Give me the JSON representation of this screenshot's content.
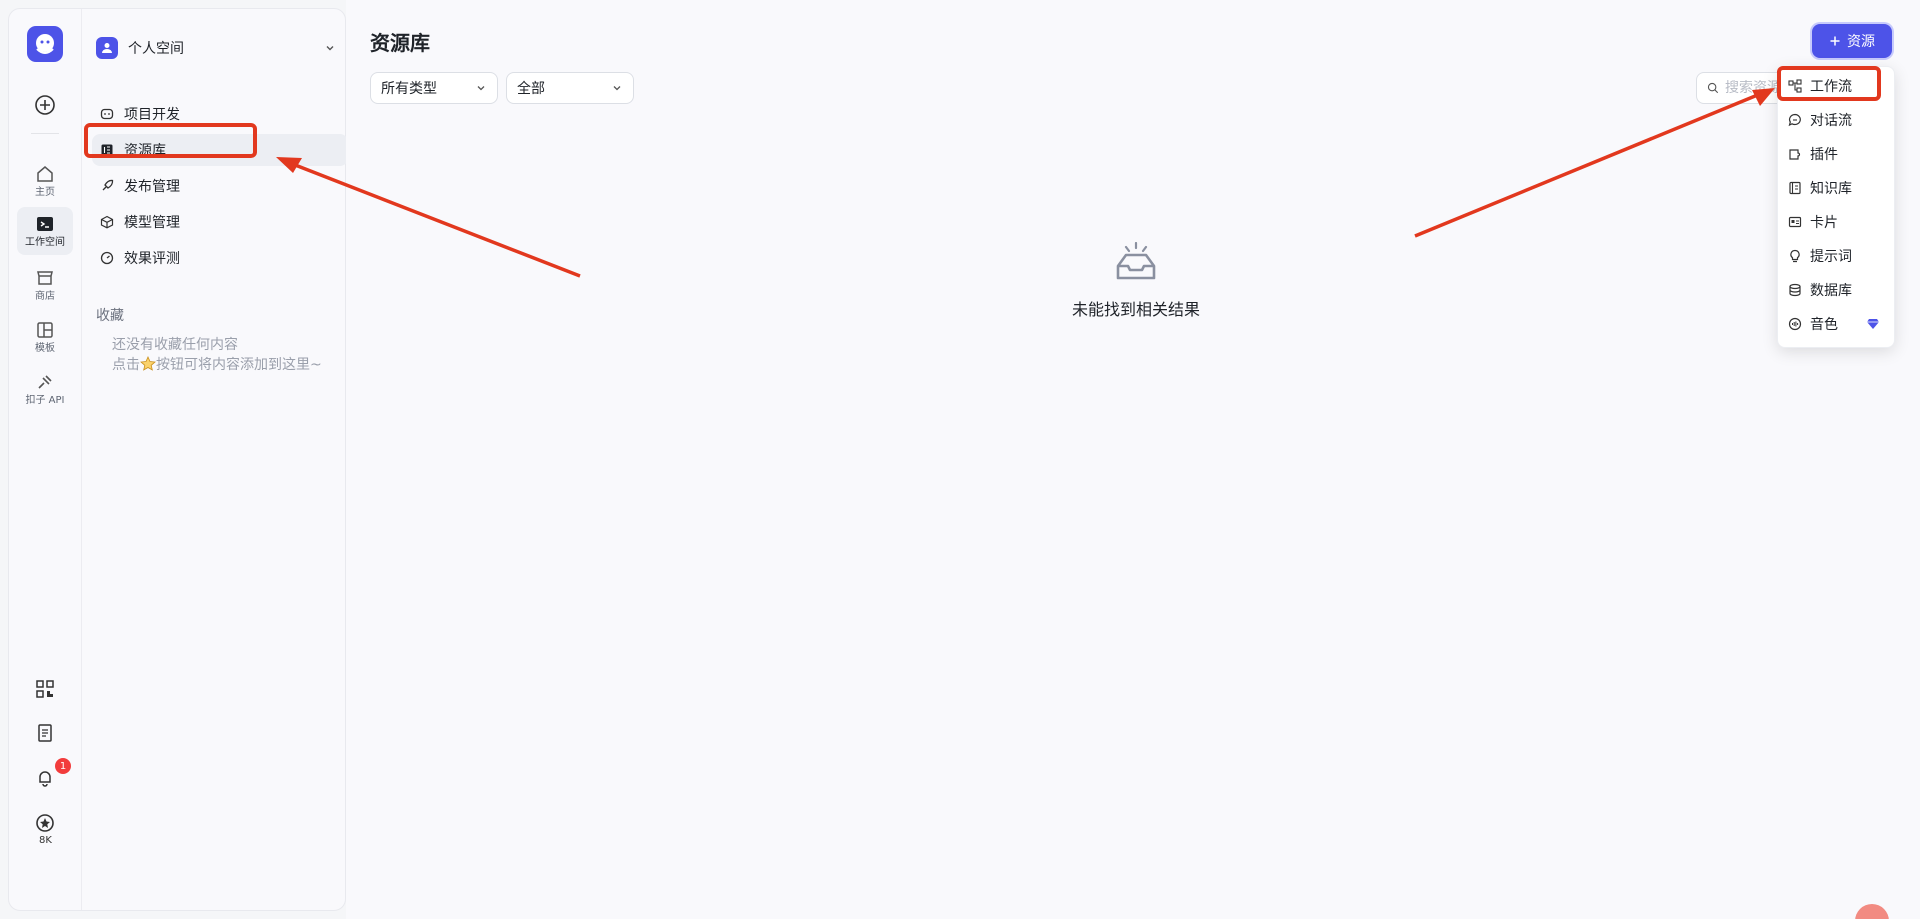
{
  "rail": {
    "items": [
      {
        "label": "主页",
        "icon": "home-icon"
      },
      {
        "label": "工作空间",
        "icon": "workspace-icon"
      },
      {
        "label": "商店",
        "icon": "store-icon"
      },
      {
        "label": "模板",
        "icon": "template-icon"
      },
      {
        "label": "扣子 API",
        "icon": "api-icon"
      }
    ],
    "notification_count": "1",
    "coins_label": "8K"
  },
  "sidebar": {
    "space_name": "个人空间",
    "nav": [
      {
        "label": "项目开发",
        "icon": "project-icon"
      },
      {
        "label": "资源库",
        "icon": "library-icon"
      },
      {
        "label": "发布管理",
        "icon": "rocket-icon"
      },
      {
        "label": "模型管理",
        "icon": "cube-icon"
      },
      {
        "label": "效果评测",
        "icon": "gauge-icon"
      }
    ],
    "favorites_title": "收藏",
    "favorites_empty_line1": "还没有收藏任何内容",
    "favorites_empty_line2_prefix": "点击",
    "favorites_empty_line2_suffix": "按钮可将内容添加到这里~"
  },
  "main": {
    "title": "资源库",
    "type_filter": "所有类型",
    "scope_filter": "全部",
    "search_placeholder": "搜索资源",
    "add_button": "资源",
    "empty_text": "未能找到相关结果"
  },
  "dropdown": {
    "items": [
      {
        "label": "工作流",
        "icon": "workflow-icon"
      },
      {
        "label": "对话流",
        "icon": "chatflow-icon"
      },
      {
        "label": "插件",
        "icon": "plugin-icon"
      },
      {
        "label": "知识库",
        "icon": "knowledge-icon"
      },
      {
        "label": "卡片",
        "icon": "card-icon"
      },
      {
        "label": "提示词",
        "icon": "prompt-icon"
      },
      {
        "label": "数据库",
        "icon": "database-icon"
      },
      {
        "label": "音色",
        "icon": "voice-icon"
      }
    ]
  },
  "colors": {
    "accent": "#4d53e8",
    "annotation": "#e2381e",
    "badge": "#f23c3c"
  }
}
